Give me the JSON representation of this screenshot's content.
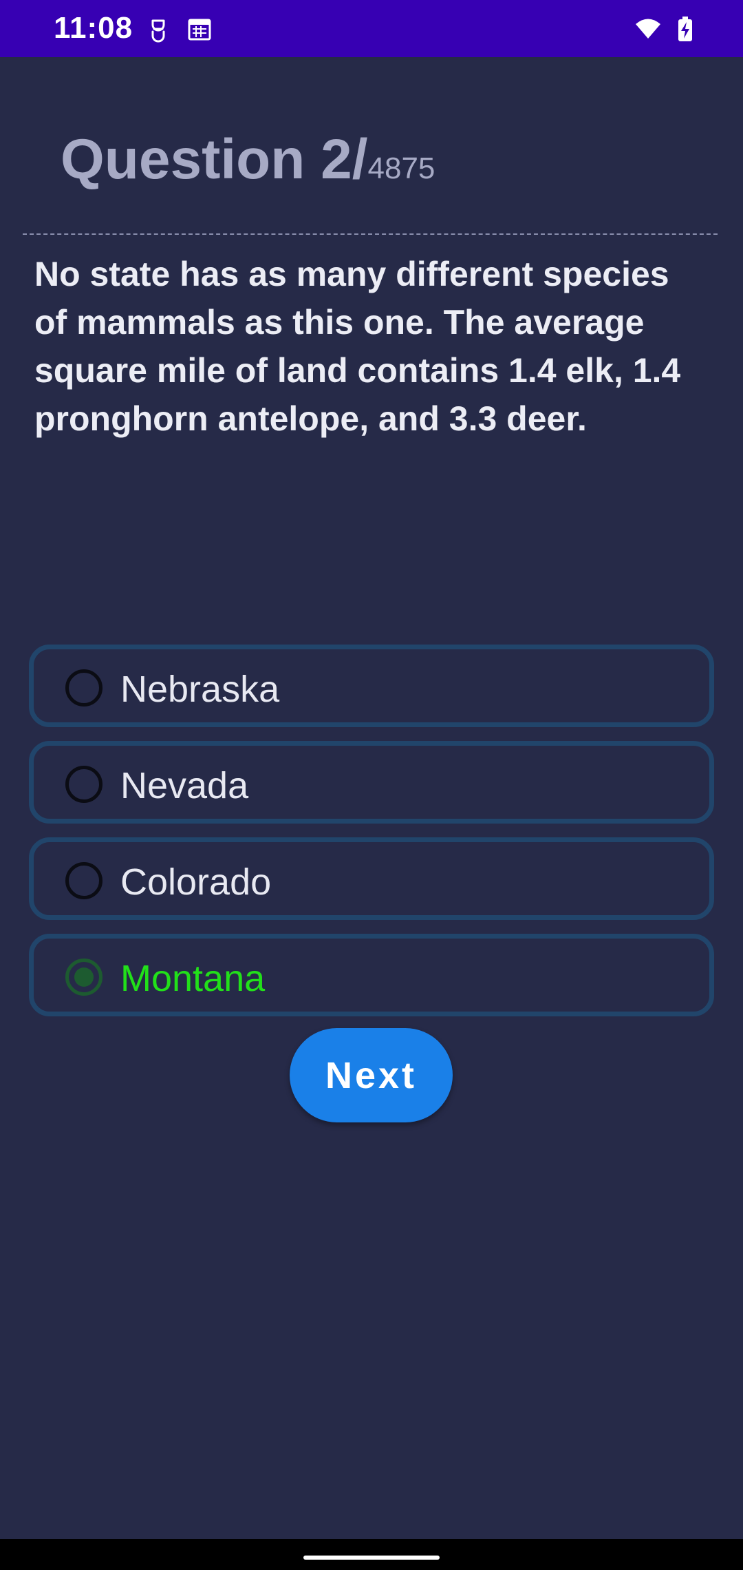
{
  "status_bar": {
    "time": "11:08",
    "icons": [
      "notification-app-icon",
      "calendar-icon",
      "wifi-icon",
      "battery-charging-icon"
    ]
  },
  "quiz": {
    "question_label": "Question 2/",
    "question_total": "4875",
    "question_text": "No state has as many different species of mammals as this one. The average square mile of land contains 1.4 elk, 1.4 pronghorn antelope, and 3.3 deer.",
    "options": [
      {
        "label": "Nebraska",
        "selected": false
      },
      {
        "label": "Nevada",
        "selected": false
      },
      {
        "label": "Colorado",
        "selected": false
      },
      {
        "label": "Montana",
        "selected": true
      }
    ],
    "next_label": "Next"
  },
  "colors": {
    "status_bar": "#3700b3",
    "background": "#262a48",
    "option_border": "#21456b",
    "selected_text": "#22e01a",
    "button": "#1a80e8"
  }
}
